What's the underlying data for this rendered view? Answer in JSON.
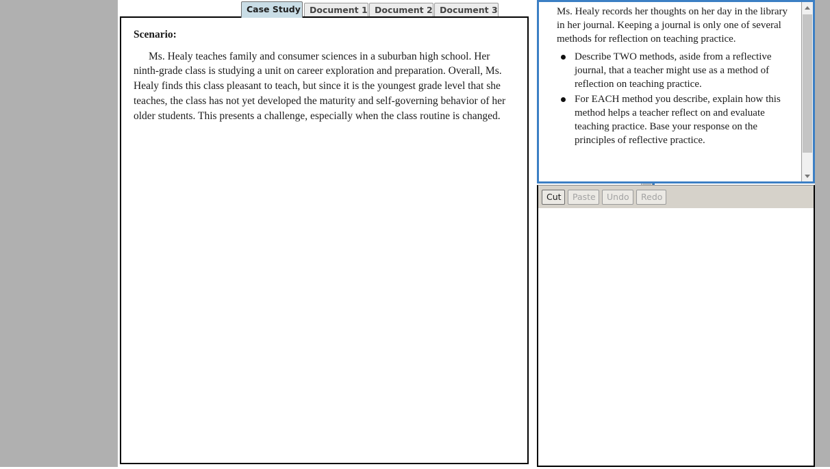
{
  "colors": {
    "accent_blue": "#3c7fc4",
    "active_tab_bg": "#c9dde6",
    "toolbar_bg": "#d6d2ca",
    "gutter_gray": "#b0b0b0"
  },
  "stimulus": {
    "tabs": [
      {
        "label": "Case Study",
        "active": true
      },
      {
        "label": "Document 1",
        "active": false
      },
      {
        "label": "Document 2",
        "active": false
      },
      {
        "label": "Document 3",
        "active": false
      }
    ],
    "heading": "Scenario:",
    "paragraph": "Ms. Healy teaches family and consumer sciences in a suburban high school. Her ninth-grade class is studying a unit on career exploration and preparation. Overall, Ms. Healy finds this class pleasant to teach, but since it is the youngest grade level that she teaches, the class has not yet developed the maturity and self-governing behavior of her older students. This presents a challenge, especially when the class routine is changed."
  },
  "prompt": {
    "paragraph": "Ms. Healy records her thoughts on her day in the library in her journal. Keeping a journal is only one of several methods for reflection on teaching practice.",
    "bullets": [
      "Describe TWO methods, aside from a reflective journal, that a teacher might use as a method of reflection on teaching practice.",
      "For EACH method you describe, explain how this method helps a teacher reflect on and evaluate teaching practice. Base your response on the principles of reflective practice."
    ]
  },
  "toolbar": {
    "cut_label": "Cut",
    "paste_label": "Paste",
    "undo_label": "Undo",
    "redo_label": "Redo"
  },
  "answer": {
    "value": "",
    "placeholder": ""
  }
}
